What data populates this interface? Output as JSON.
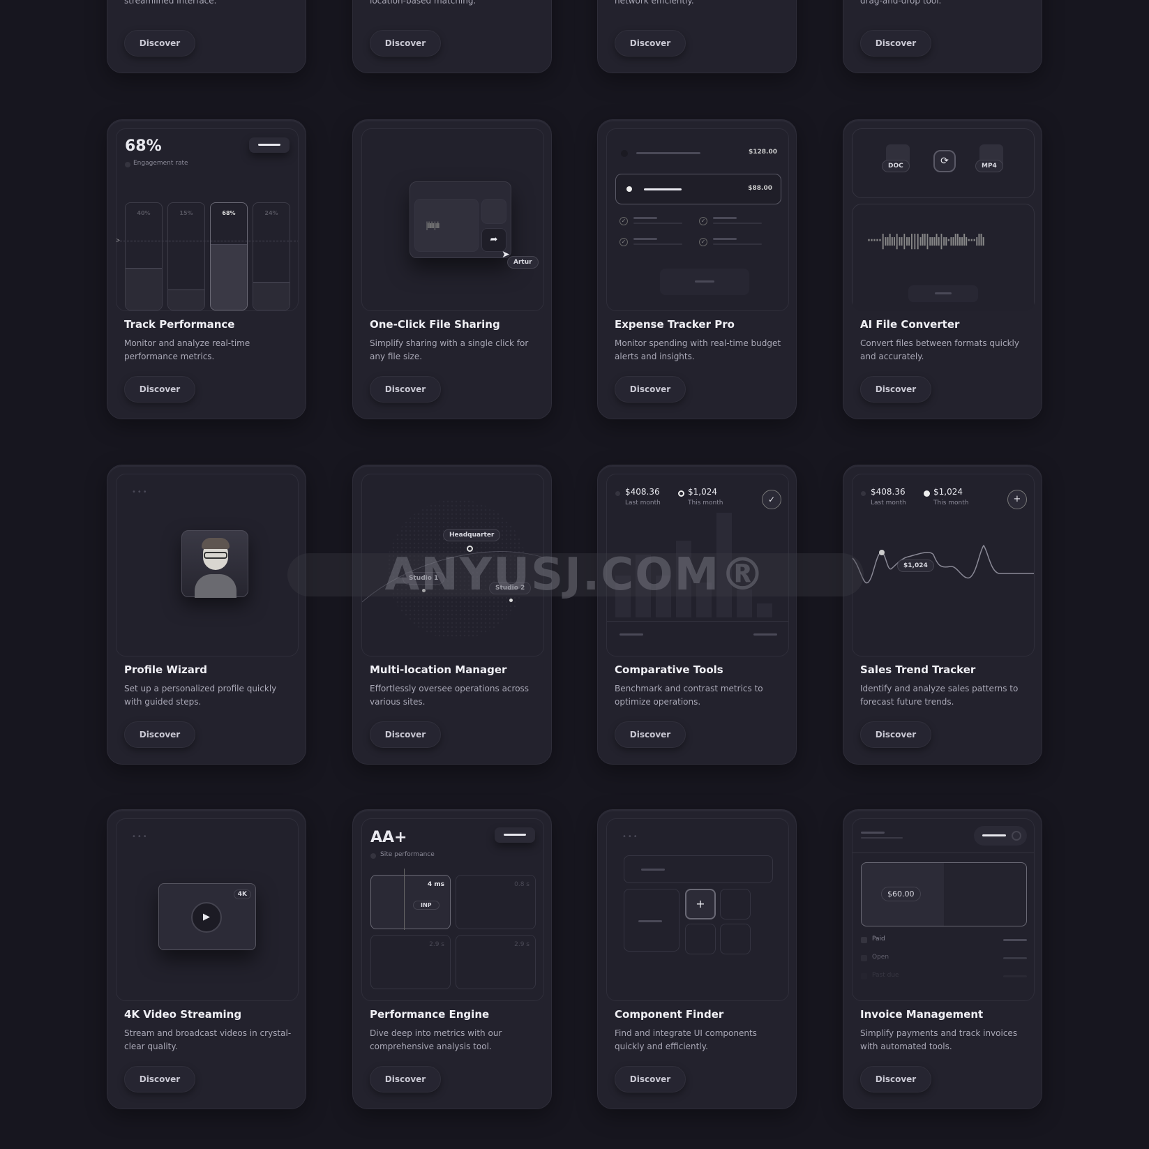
{
  "top_row": [
    {
      "desc": "Link all your essential tools in one streamlined interface.",
      "button": "Discover"
    },
    {
      "desc": "Connect with new friends nearby with location-based matching.",
      "button": "Discover"
    },
    {
      "desc": "Build and manage your professional network efficiently.",
      "button": "Discover"
    },
    {
      "desc": "Easily create layouts with our intuitive drag-and-drop tool.",
      "button": "Discover"
    }
  ],
  "cards": [
    {
      "title": "Track Performance",
      "desc": "Monitor and analyze real-time performance metrics.",
      "button": "Discover"
    },
    {
      "title": "One-Click File Sharing",
      "desc": "Simplify sharing with a single click for any file size.",
      "button": "Discover"
    },
    {
      "title": "Expense Tracker Pro",
      "desc": "Monitor spending with real-time budget alerts and insights.",
      "button": "Discover"
    },
    {
      "title": "AI File Converter",
      "desc": "Convert files between formats quickly and accurately.",
      "button": "Discover"
    },
    {
      "title": "Profile Wizard",
      "desc": "Set up a personalized profile quickly with guided steps.",
      "button": "Discover"
    },
    {
      "title": "Multi-location Manager",
      "desc": "Effortlessly oversee operations across various sites.",
      "button": "Discover"
    },
    {
      "title": "Comparative Tools",
      "desc": "Benchmark and contrast metrics to optimize operations.",
      "button": "Discover"
    },
    {
      "title": "Sales Trend Tracker",
      "desc": "Identify and analyze sales patterns to forecast future trends.",
      "button": "Discover"
    },
    {
      "title": "4K Video Streaming",
      "desc": "Stream and broadcast videos in crystal-clear quality.",
      "button": "Discover"
    },
    {
      "title": "Performance Engine",
      "desc": "Dive deep into metrics with our comprehensive analysis tool.",
      "button": "Discover"
    },
    {
      "title": "Component Finder",
      "desc": "Find and integrate UI components quickly and efficiently.",
      "button": "Discover"
    },
    {
      "title": "Invoice Management",
      "desc": "Simplify payments and track invoices with automated tools.",
      "button": "Discover"
    }
  ],
  "track": {
    "value": "68%",
    "label": "Engagement rate",
    "bars": [
      {
        "label": "40%",
        "value": 40
      },
      {
        "label": "15%",
        "value": 15
      },
      {
        "label": "68%",
        "value": 68,
        "active": true
      },
      {
        "label": "24%",
        "value": 24
      }
    ]
  },
  "sharing": {
    "user": "Artur"
  },
  "expense": {
    "amount1": "$128.00",
    "amount2": "$88.00"
  },
  "converter": {
    "from": "DOC",
    "to": "MP4"
  },
  "locations": {
    "hq": "Headquarter",
    "s1": "Studio 1",
    "s2": "Studio 2"
  },
  "comparative": {
    "last_value": "$408.36",
    "last_label": "Last month",
    "this_value": "$1,024",
    "this_label": "This month"
  },
  "sales": {
    "last_value": "$408.36",
    "last_label": "Last month",
    "this_value": "$1,024",
    "this_label": "This month",
    "tooltip": "$1,024"
  },
  "video": {
    "badge": "4K"
  },
  "perf": {
    "grade": "AA+",
    "label": "Site performance",
    "metric": "4 ms",
    "metric_tag": "INP",
    "cells": [
      "0.8 s",
      "2.9 s",
      "2.9 s"
    ]
  },
  "invoice": {
    "amount": "$60.00",
    "statuses": [
      "Paid",
      "Open",
      "Past due"
    ]
  },
  "watermark": "ANYUSJ.COM®",
  "colors": {
    "background": "#17161f",
    "card": "#23222d",
    "text": "#f0f0f5",
    "muted": "#a9a8b6"
  }
}
